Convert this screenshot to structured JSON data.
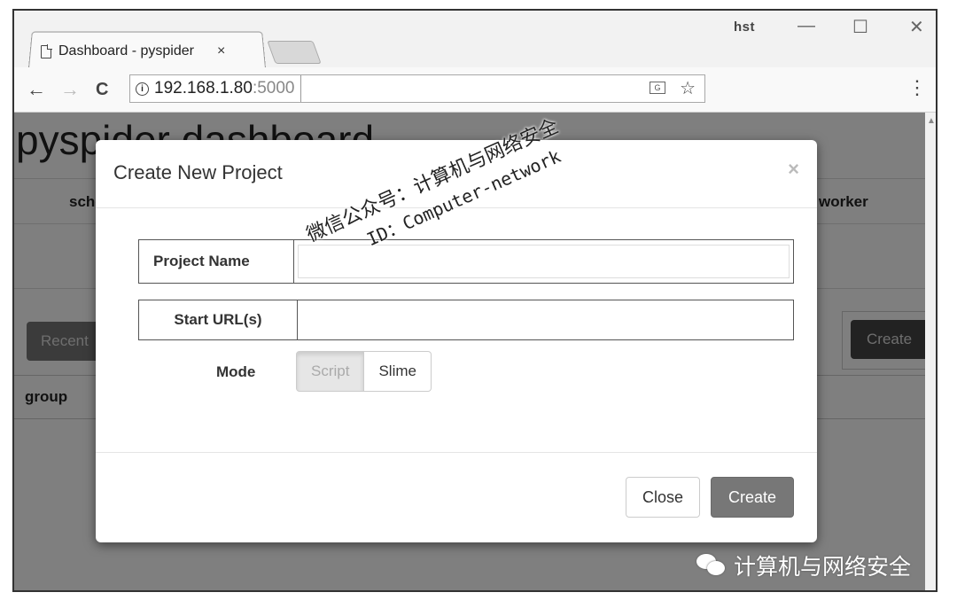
{
  "browser": {
    "tab_title": "Dashboard - pyspider",
    "tab_close": "×",
    "user_badge": "hst",
    "window_minimize": "—",
    "window_maximize": "☐",
    "window_close": "✕",
    "nav_back": "←",
    "nav_forward": "→",
    "nav_reload": "C",
    "url_host": "192.168.1.80",
    "url_port": ":5000",
    "star": "☆",
    "menu": "⋮"
  },
  "page": {
    "title": "pyspider dashboard",
    "status_left": "sche",
    "status_right": "worker",
    "recent_button": "Recent Active",
    "create_button": "Create",
    "table_col_group": "group"
  },
  "modal": {
    "title": "Create New Project",
    "close_x": "×",
    "project_name_label": "Project Name",
    "project_name_value": "",
    "start_urls_label": "Start URL(s)",
    "start_urls_value": "",
    "mode_label": "Mode",
    "mode_options": [
      "Script",
      "Slime"
    ],
    "mode_selected": "Script",
    "close_button": "Close",
    "create_button": "Create"
  },
  "watermark": {
    "line1": "微信公众号：计算机与网络安全",
    "line2": "ID：Computer-network"
  },
  "source_credit": "计算机与网络安全"
}
